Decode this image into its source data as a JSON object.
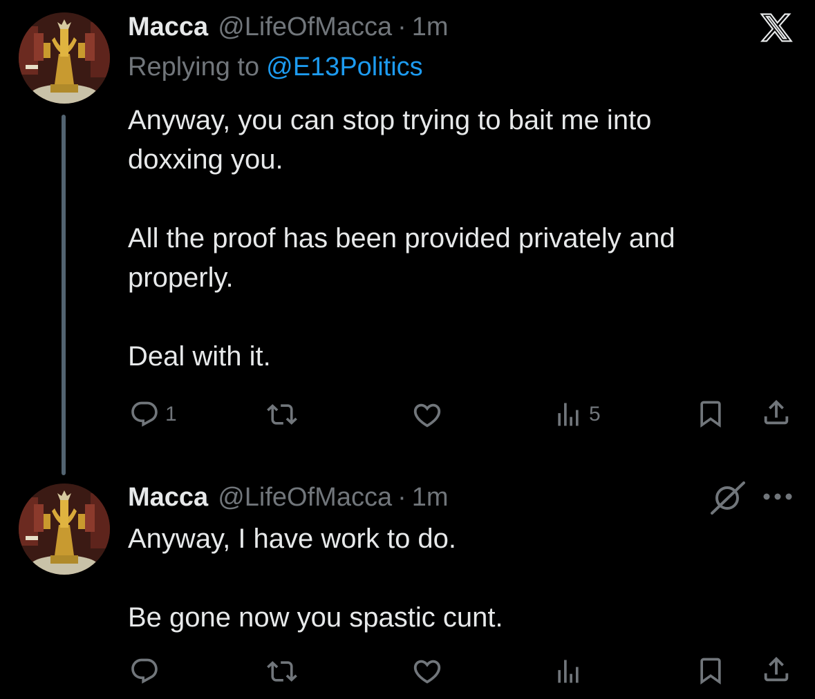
{
  "tweets": [
    {
      "author_name": "Macca",
      "author_handle": "@LifeOfMacca",
      "separator": "·",
      "timestamp": "1m",
      "replying_prefix": "Replying to",
      "replying_to": "@E13Politics",
      "paragraphs": [
        "Anyway, you can stop trying to bait me into doxxing you.",
        "All the proof has been provided privately and properly.",
        "Deal with it."
      ],
      "reply_count": "1",
      "views_count": "5"
    },
    {
      "author_name": "Macca",
      "author_handle": "@LifeOfMacca",
      "separator": "·",
      "timestamp": "1m",
      "paragraphs": [
        "Anyway, I have work to do.",
        "Be gone now you spastic cunt."
      ]
    }
  ],
  "icons": {
    "app_logo": "x-logo-icon",
    "reply": "speech-bubble-icon",
    "repost": "repost-arrows-icon",
    "like": "heart-icon",
    "views": "bar-chart-icon",
    "bookmark": "bookmark-icon",
    "share": "share-upload-icon",
    "grok": "grok-slash-circle-icon",
    "more": "ellipsis-icon"
  },
  "colors": {
    "background": "#000000",
    "text_primary": "#e7e9ea",
    "text_secondary": "#71767b",
    "link": "#1d9bf0",
    "thread_line": "#536471"
  }
}
